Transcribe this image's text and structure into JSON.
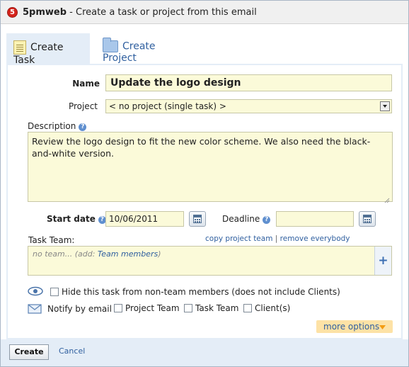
{
  "window": {
    "app_name": "5pmweb",
    "title_suffix": " - Create a task or project from this email",
    "logo_glyph": "5"
  },
  "tabs": [
    {
      "label": "Create Task",
      "icon": "document-icon",
      "active": true
    },
    {
      "label": "Create Project",
      "icon": "folder-icon",
      "active": false
    }
  ],
  "form": {
    "name_label": "Name",
    "name_value": "Update the logo design",
    "project_label": "Project",
    "project_value": "< no project (single task) >",
    "description_label": "Description",
    "description_value": "Review the logo design to fit the new color scheme. We also need the black-and-white version.",
    "start_date_label": "Start date",
    "start_date_value": "10/06/2011",
    "deadline_label": "Deadline",
    "deadline_value": "",
    "task_team_label": "Task Team:",
    "copy_team_link": "copy project team",
    "link_separator": "|",
    "remove_everybody_link": "remove everybody",
    "team_empty_text": "no team... (add: ",
    "team_members_link": "Team members",
    "team_empty_close": ")",
    "add_member_glyph": "+",
    "help_glyph": "?",
    "hide_task_label": "Hide this task from non-team members (does not include Clients)",
    "notify_label": "Notify by email",
    "notify_project_team": "Project Team",
    "notify_task_team": "Task Team",
    "notify_clients": "Client(s)",
    "more_options": "more options"
  },
  "footer": {
    "create_label": "Create",
    "cancel_label": "Cancel"
  },
  "colors": {
    "accent_link": "#2f5f9f",
    "field_background": "#fbfad9",
    "panel_background": "#e4edf7",
    "more_options_bg": "#fde2a6",
    "logo_red": "#d5231b"
  }
}
